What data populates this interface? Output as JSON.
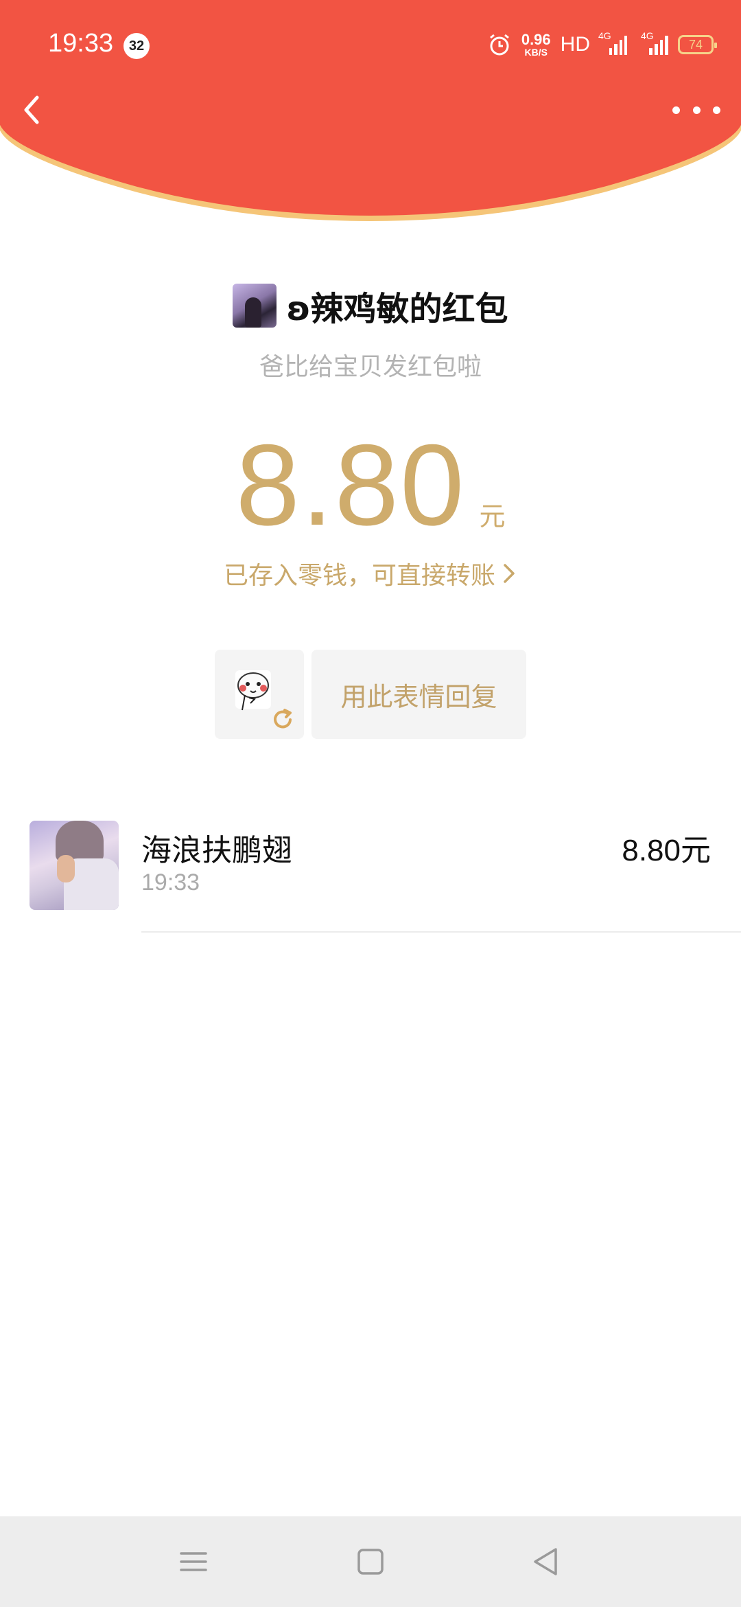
{
  "status_bar": {
    "time": "19:33",
    "notification_count": "32",
    "net_speed_value": "0.96",
    "net_speed_unit": "KB/S",
    "hd_label": "HD",
    "signal_1_label": "4G",
    "signal_2_label": "4G",
    "battery_level": "74",
    "icons": [
      "alarm-icon",
      "signal-icon",
      "signal-icon",
      "battery-icon"
    ]
  },
  "header": {
    "color": "#f25443",
    "back_icon": "chevron-left-icon",
    "more_icon": "more-dots-icon"
  },
  "red_packet": {
    "sender_title": "ʚ辣鸡敏的红包",
    "blessing": "爸比给宝贝发红包啦",
    "amount": "8.80",
    "unit": "元",
    "wallet_link": "已存入零钱，可直接转账",
    "accent_color": "#cfac6c"
  },
  "emoji_reply": {
    "emoji_icon": "sticker-face-icon",
    "refresh_icon": "refresh-icon",
    "button_label": "用此表情回复"
  },
  "receivers": [
    {
      "name": "海浪扶鹏翅",
      "time": "19:33",
      "amount": "8.80元"
    }
  ],
  "nav_bar": {
    "icons": [
      "menu-icon",
      "home-icon",
      "back-icon"
    ]
  }
}
